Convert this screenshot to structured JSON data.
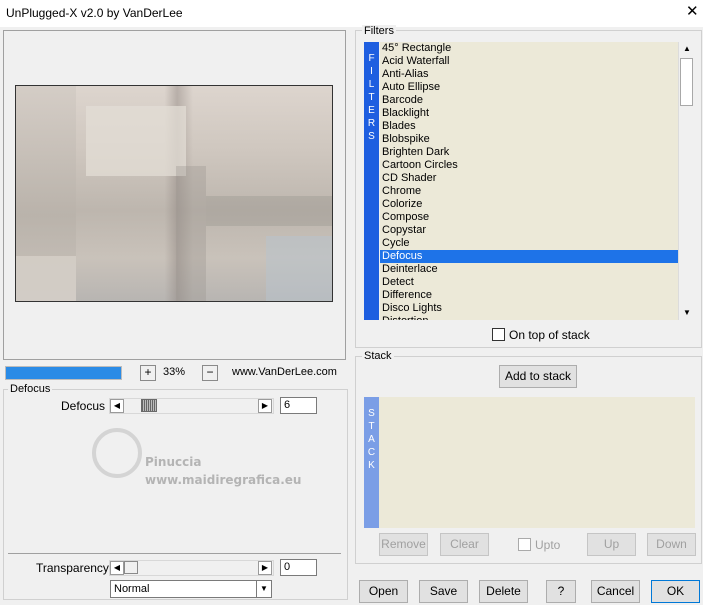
{
  "window": {
    "title": "UnPlugged-X v2.0 by VanDerLee",
    "close_glyph": "✕"
  },
  "preview": {
    "progress_fraction": 1.0,
    "zoom_minus": "−",
    "zoom_plus": "+",
    "zoom_value": "33%",
    "website": "www.VanDerLee.com"
  },
  "defocus_group": {
    "label": "Defocus",
    "param_label": "Defocus",
    "param_value": "6",
    "left_arrow": "◀",
    "right_arrow": "▶"
  },
  "watermark": {
    "name": "Pinuccia",
    "site": "www.maidiregrafica.eu"
  },
  "transparency": {
    "label": "Transparency",
    "value": "0",
    "blend_mode": "Normal",
    "combo_arrow": "▼"
  },
  "filters": {
    "label": "Filters",
    "strip_letters": [
      "F",
      "I",
      "L",
      "T",
      "E",
      "R",
      "S"
    ],
    "items": [
      "45° Rectangle",
      "Acid Waterfall",
      "Anti-Alias",
      "Auto Ellipse",
      "Barcode",
      "Blacklight",
      "Blades",
      "Blobspike",
      "Brighten Dark",
      "Cartoon Circles",
      "CD Shader",
      "Chrome",
      "Colorize",
      "Compose",
      "Copystar",
      "Cycle",
      "Defocus",
      "Deinterlace",
      "Detect",
      "Difference",
      "Disco Lights",
      "Distortion"
    ],
    "selected": "Defocus",
    "on_top_label": "On top of stack",
    "scroll_up": "▲",
    "scroll_down": "▼"
  },
  "stack": {
    "label": "Stack",
    "add_button": "Add to stack",
    "strip_letters": [
      "S",
      "T",
      "A",
      "C",
      "K"
    ],
    "remove": "Remove",
    "clear": "Clear",
    "upto": "Upto",
    "up": "Up",
    "down": "Down"
  },
  "bottom_buttons": {
    "open": "Open",
    "save": "Save",
    "delete": "Delete",
    "help": "?",
    "cancel": "Cancel",
    "ok": "OK"
  },
  "colors": {
    "accent": "#1e73e8",
    "strip": "#1e5ee0",
    "list_bg": "#ece9d8"
  }
}
